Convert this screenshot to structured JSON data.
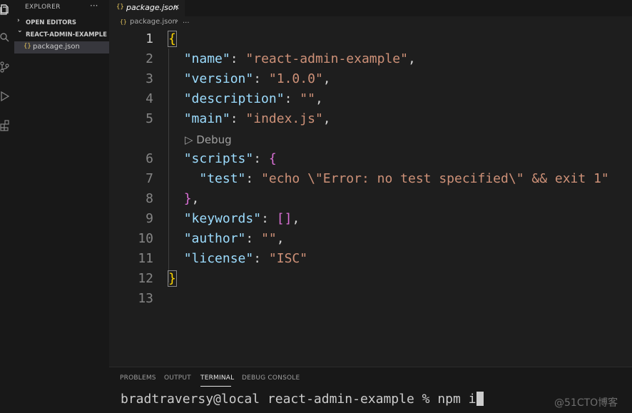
{
  "sidebar": {
    "title": "EXPLORER",
    "more": "···",
    "open_editors": "OPEN EDITORS",
    "project": "REACT-ADMIN-EXAMPLE",
    "file": "package.json",
    "chevron_open_editors": "›",
    "chevron_project": "⌄"
  },
  "tab": {
    "icon": "{}",
    "label": "package.json",
    "close": "×"
  },
  "breadcrumb": {
    "icon": "{}",
    "file": "package.json",
    "sep": "›",
    "more": "..."
  },
  "codelens": "▷ Debug",
  "line_numbers": [
    "1",
    "2",
    "3",
    "4",
    "5",
    "6",
    "7",
    "8",
    "9",
    "10",
    "11",
    "12",
    "13"
  ],
  "code": {
    "open": "{",
    "name_key": "\"name\"",
    "name_val": "\"react-admin-example\"",
    "version_key": "\"version\"",
    "version_val": "\"1.0.0\"",
    "description_key": "\"description\"",
    "description_val": "\"\"",
    "main_key": "\"main\"",
    "main_val": "\"index.js\"",
    "scripts_key": "\"scripts\"",
    "scripts_open": "{",
    "test_key": "\"test\"",
    "test_val": "\"echo \\\"Error: no test specified\\\" && exit 1\"",
    "scripts_close": "}",
    "keywords_key": "\"keywords\"",
    "keywords_val": "[]",
    "author_key": "\"author\"",
    "author_val": "\"\"",
    "license_key": "\"license\"",
    "license_val": "\"ISC\"",
    "close": "}",
    "colon": ": ",
    "comma": ","
  },
  "panel": {
    "tabs": [
      "PROBLEMS",
      "OUTPUT",
      "TERMINAL",
      "DEBUG CONSOLE"
    ],
    "active_tab": "TERMINAL",
    "terminal_prompt": "bradtraversy@local react-admin-example % npm i"
  },
  "watermark": "@51CTO博客",
  "icons": [
    "files-icon",
    "search-icon",
    "source-control-icon",
    "run-debug-icon",
    "extensions-icon"
  ],
  "colors": {
    "key": "#9cdcfe",
    "string": "#ce9178",
    "brace": "#ffd700",
    "nested_brace": "#da70d6"
  }
}
